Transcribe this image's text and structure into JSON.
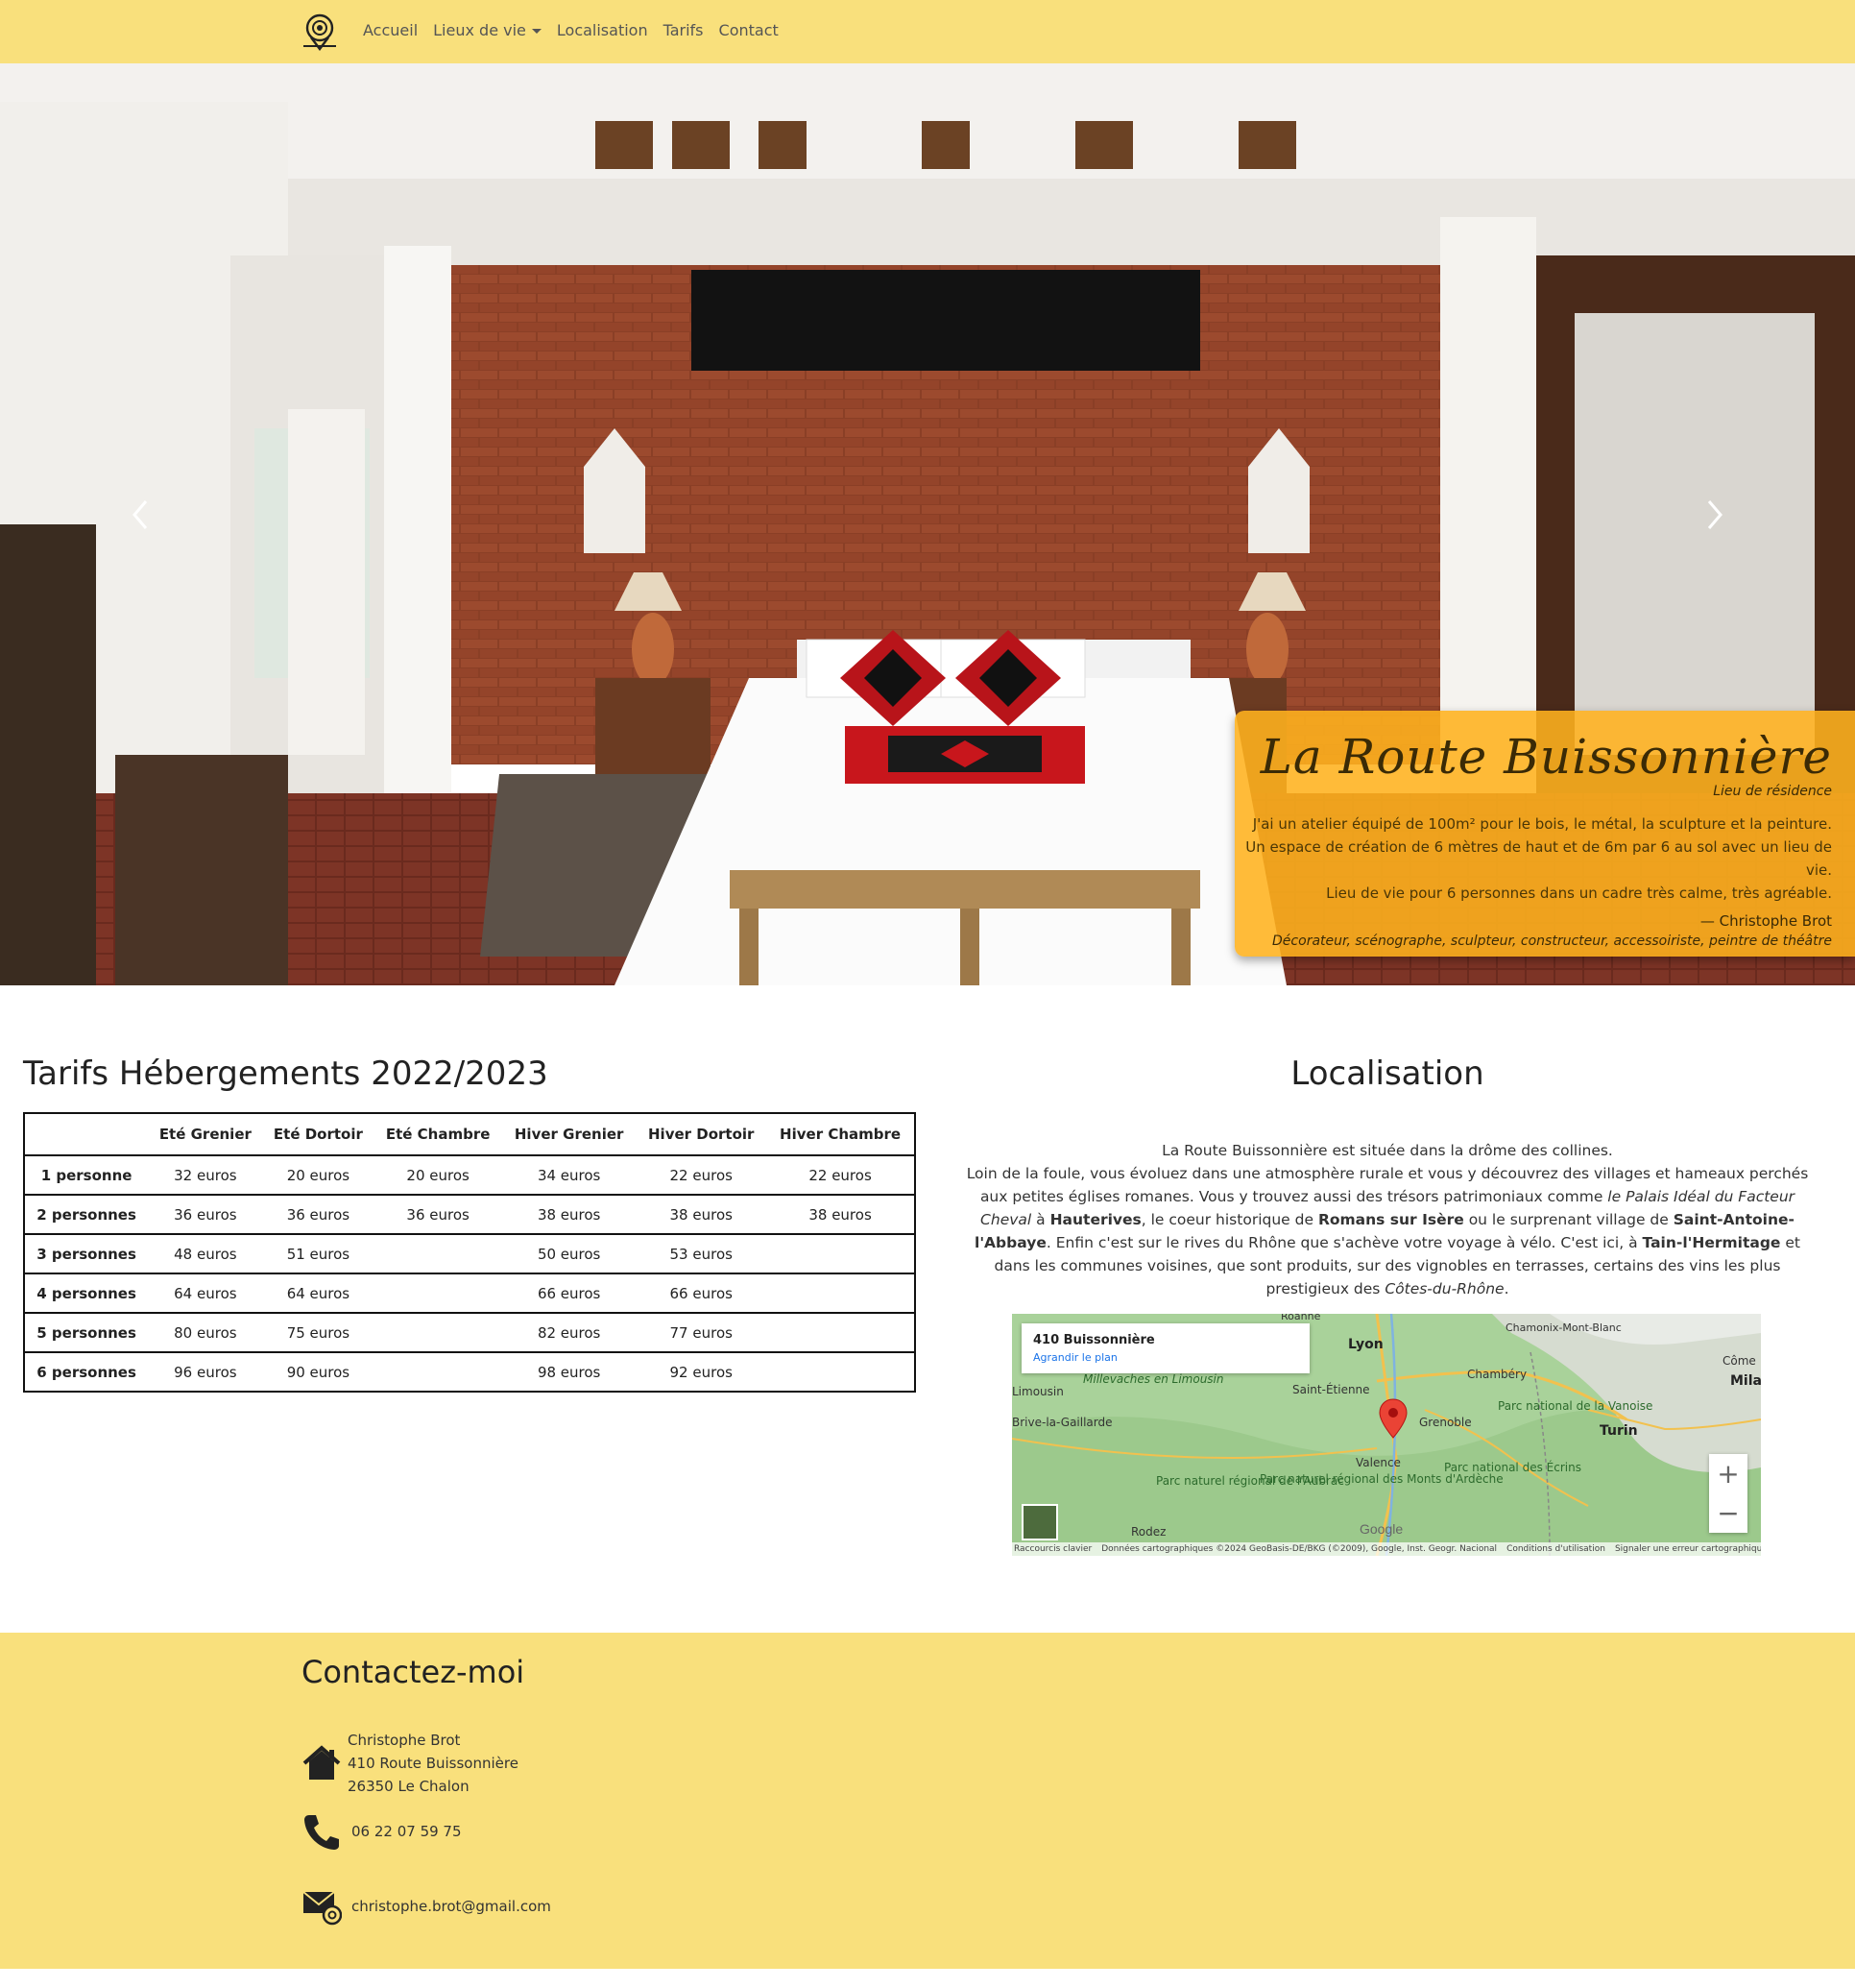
{
  "nav": {
    "logo_icon": "location-pin-icon",
    "items": [
      "Accueil",
      "Lieux de vie",
      "Localisation",
      "Tarifs",
      "Contact"
    ]
  },
  "carousel": {
    "prev_icon": "chevron-left-icon",
    "next_icon": "chevron-right-icon",
    "caption": {
      "title": "La Route Buissonnière",
      "subtitle": "Lieu de résidence",
      "quote_lines": [
        "J'ai un atelier équipé de 100m² pour le bois, le métal, la sculpture et la peinture.",
        "Un espace de création de 6 mètres de haut et de 6m par 6 au sol avec un lieu de vie.",
        "Lieu de vie pour 6 personnes dans un cadre très calme, très agréable."
      ],
      "author": "— Christophe Brot",
      "role": "Décorateur, scénographe, sculpteur, constructeur, accessoiriste, peintre de théâtre"
    }
  },
  "tarifs": {
    "title": "Tarifs Hébergements 2022/2023",
    "headers": [
      "",
      "Eté Grenier",
      "Eté Dortoir",
      "Eté Chambre",
      "Hiver Grenier",
      "Hiver Dortoir",
      "Hiver Chambre"
    ],
    "rows": [
      [
        "1 personne",
        "32 euros",
        "20 euros",
        "20 euros",
        "34 euros",
        "22 euros",
        "22 euros"
      ],
      [
        "2 personnes",
        "36 euros",
        "36 euros",
        "36 euros",
        "38 euros",
        "38 euros",
        "38 euros"
      ],
      [
        "3 personnes",
        "48 euros",
        "51 euros",
        "",
        "50 euros",
        "53 euros",
        ""
      ],
      [
        "4 personnes",
        "64 euros",
        "64 euros",
        "",
        "66 euros",
        "66 euros",
        ""
      ],
      [
        "5 personnes",
        "80 euros",
        "75 euros",
        "",
        "82 euros",
        "77 euros",
        ""
      ],
      [
        "6 personnes",
        "96 euros",
        "90 euros",
        "",
        "98 euros",
        "92 euros",
        ""
      ]
    ]
  },
  "localisation": {
    "title": "Localisation",
    "p1": "La Route Buissonnière est située dans la drôme des collines.",
    "p2a": "Loin de la foule, vous évoluez dans une atmosphère rurale et vous y découvrez des villages et hameaux perchés aux petites églises romanes. Vous y trouvez aussi des trésors patrimoniaux comme ",
    "p2_palais": "le Palais Idéal du Facteur Cheval",
    "p2b": " à ",
    "p2_hauterives": "Hauterives",
    "p2c": ", le coeur historique de ",
    "p2_romans": "Romans sur Isère",
    "p2d": " ou le surprenant village de ",
    "p2_saint": "Saint-Antoine-l'Abbaye",
    "p2e": ". Enfin c'est sur le rives du Rhône que s'achève votre voyage à vélo. C'est ici, à ",
    "p2_tain": "Tain-l'Hermitage",
    "p2f": " et dans les communes voisines, que sont produits, sur des vignobles en terrasses, certains des vins les plus prestigieux des ",
    "p2_cotes": "Côtes-du-Rhône",
    "p2g": ".",
    "map": {
      "place": "410 Buissonnière",
      "link": "Agrandir le plan",
      "zoom_in": "+",
      "zoom_out": "−",
      "labels": [
        "Lyon",
        "Grenoble",
        "Turin",
        "Valence",
        "Chambéry",
        "Saint-Étienne",
        "Brive-la-Gaillarde",
        "Rodez",
        "Chamonix-Mont-Blanc",
        "Côme",
        "Mila",
        "Roanne",
        "Limousin",
        "Millevaches en Limousin"
      ],
      "parks": [
        "Parc national de la Vanoise",
        "Parc national des Écrins",
        "Parc naturel régional de l'Aubrac",
        "Parc naturel régional des Monts d'Ardèche"
      ],
      "footer": [
        "Raccourcis clavier",
        "Données cartographiques ©2024 GeoBasis-DE/BKG (©2009), Google, Inst. Geogr. Nacional",
        "Conditions d'utilisation",
        "Signaler une erreur cartographique"
      ],
      "google": "Google"
    }
  },
  "contact": {
    "title": "Contactez-moi",
    "address": [
      "Christophe Brot",
      "410 Route Buissonnière",
      "26350 Le Chalon"
    ],
    "phone": "06 22 07 59 75",
    "email": "christophe.brot@gmail.com",
    "icons": [
      "home-icon",
      "phone-icon",
      "mail-at-icon"
    ]
  }
}
